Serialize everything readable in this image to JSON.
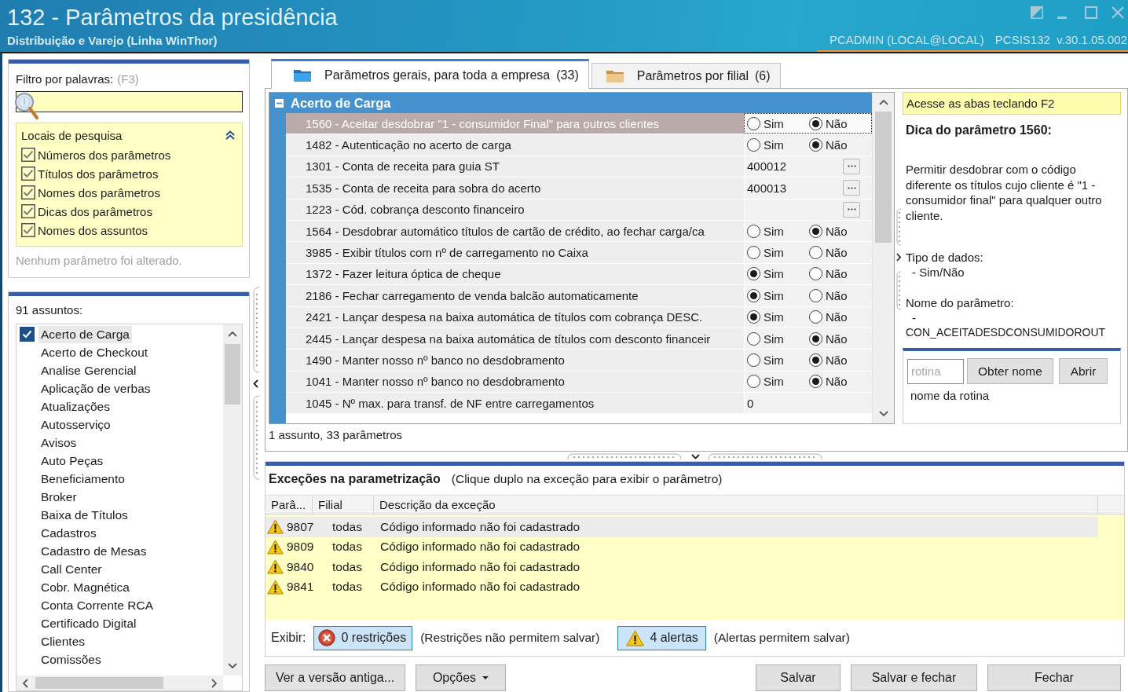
{
  "window": {
    "title": "132 - Parâmetros da presidência",
    "subtitle": "Distribuição e Varejo (Linha WinThor)",
    "user": "PCADMIN (LOCAL@LOCAL)",
    "version": "PCSIS132  v.30.1.05.002"
  },
  "filter": {
    "label": "Filtro por palavras:",
    "shortcut": "(F3)",
    "search_places": {
      "title": "Locais de pesquisa",
      "expanded": true,
      "options": [
        {
          "label": "Números dos parâmetros",
          "checked": true
        },
        {
          "label": "Títulos dos parâmetros",
          "checked": true
        },
        {
          "label": "Nomes dos parâmetros",
          "checked": true
        },
        {
          "label": "Dicas dos parâmetros",
          "checked": true
        },
        {
          "label": "Nomes dos assuntos",
          "checked": true
        }
      ]
    },
    "status": "Nenhum parâmetro foi alterado."
  },
  "subjects": {
    "count": "91 assuntos:",
    "items": [
      {
        "label": "Acerto de Carga",
        "checked": true,
        "selected": true
      },
      {
        "label": "Acerto de Checkout",
        "checked": false,
        "selected": false
      },
      {
        "label": "Analise Gerencial",
        "checked": false,
        "selected": false
      },
      {
        "label": "Aplicação de verbas",
        "checked": false,
        "selected": false
      },
      {
        "label": "Atualizações",
        "checked": false,
        "selected": false
      },
      {
        "label": "Autosserviço",
        "checked": false,
        "selected": false
      },
      {
        "label": "Avisos",
        "checked": false,
        "selected": false
      },
      {
        "label": "Auto Peças",
        "checked": false,
        "selected": false
      },
      {
        "label": "Beneficiamento",
        "checked": false,
        "selected": false
      },
      {
        "label": "Broker",
        "checked": false,
        "selected": false
      },
      {
        "label": "Baixa de Títulos",
        "checked": false,
        "selected": false
      },
      {
        "label": "Cadastros",
        "checked": false,
        "selected": false
      },
      {
        "label": "Cadastro de Mesas",
        "checked": false,
        "selected": false
      },
      {
        "label": "Call Center",
        "checked": false,
        "selected": false
      },
      {
        "label": "Cobr. Magnética",
        "checked": false,
        "selected": false
      },
      {
        "label": "Conta Corrente RCA",
        "checked": false,
        "selected": false
      },
      {
        "label": "Certificado Digital",
        "checked": false,
        "selected": false
      },
      {
        "label": "Clientes",
        "checked": false,
        "selected": false
      },
      {
        "label": "Comissões",
        "checked": false,
        "selected": false
      }
    ]
  },
  "tabs": [
    {
      "label": "Parâmetros gerais, para toda a empresa",
      "count": "(33)",
      "selected": true
    },
    {
      "label": "Parâmetros por filial",
      "count": "(6)",
      "selected": false
    }
  ],
  "parameters": {
    "group": {
      "title": "Acerto de Carga",
      "expanded": true
    },
    "rows": [
      {
        "label": "1560 - Aceitar desdobrar \"1 - consumidor Final\" para outros clientes",
        "kind": "yesno",
        "selected": true,
        "options": [
          {
            "label": "Sim",
            "selected": false
          },
          {
            "label": "Não",
            "selected": true
          }
        ]
      },
      {
        "label": "1482 - Autenticação no acerto de carga",
        "kind": "yesno",
        "selected": false,
        "options": [
          {
            "label": "Sim",
            "selected": false
          },
          {
            "label": "Não",
            "selected": true
          }
        ]
      },
      {
        "label": "1301 - Conta de receita para guia ST",
        "kind": "lookup",
        "selected": false,
        "value": "400012"
      },
      {
        "label": "1535 - Conta de receita para sobra do acerto",
        "kind": "lookup",
        "selected": false,
        "value": "400013"
      },
      {
        "label": "1223 - Cód. cobrança desconto financeiro",
        "kind": "lookup",
        "selected": false
      },
      {
        "label": "1564 - Desdobrar automático títulos de cartão de crédito, ao fechar carga/ca",
        "kind": "yesno",
        "selected": false,
        "options": [
          {
            "label": "Sim",
            "selected": false
          },
          {
            "label": "Não",
            "selected": true
          }
        ]
      },
      {
        "label": "3985 - Exibir títulos com nº de carregamento no Caixa",
        "kind": "yesno",
        "selected": false,
        "options": [
          {
            "label": "Sim",
            "selected": false
          },
          {
            "label": "Não",
            "selected": false
          }
        ]
      },
      {
        "label": "1372 - Fazer leitura óptica de cheque",
        "kind": "yesno",
        "selected": false,
        "options": [
          {
            "label": "Sim",
            "selected": true
          },
          {
            "label": "Não",
            "selected": false
          }
        ]
      },
      {
        "label": "2186 - Fechar carregamento de venda balcão automaticamente",
        "kind": "yesno",
        "selected": false,
        "options": [
          {
            "label": "Sim",
            "selected": true
          },
          {
            "label": "Não",
            "selected": false
          }
        ]
      },
      {
        "label": "2421 - Lançar despesa na baixa automática de títulos com cobrança DESC.",
        "kind": "yesno",
        "selected": false,
        "options": [
          {
            "label": "Sim",
            "selected": true
          },
          {
            "label": "Não",
            "selected": false
          }
        ]
      },
      {
        "label": "2445 - Lançar despesa na baixa automática de títulos com desconto financeir",
        "kind": "yesno",
        "selected": false,
        "options": [
          {
            "label": "Sim",
            "selected": false
          },
          {
            "label": "Não",
            "selected": true
          }
        ]
      },
      {
        "label": "1490 - Manter nosso nº banco no desdobramento",
        "kind": "yesno",
        "selected": false,
        "options": [
          {
            "label": "Sim",
            "selected": false
          },
          {
            "label": "Não",
            "selected": true
          }
        ]
      },
      {
        "label": "1041 - Manter nosso nº banco no desdobramento",
        "kind": "yesno",
        "selected": false,
        "options": [
          {
            "label": "Sim",
            "selected": false
          },
          {
            "label": "Não",
            "selected": true
          }
        ]
      },
      {
        "label": "1045 - Nº max. para transf. de NF entre carregamentos",
        "kind": "number",
        "selected": false,
        "value": "0"
      }
    ],
    "summary": "1 assunto, 33 parâmetros"
  },
  "hint": {
    "shortcut_note": "Acesse as abas teclando F2",
    "heading": "Dica do parâmetro 1560:",
    "description": "Permitir desdobrar com o código diferente os títulos cujo cliente é \"1 - consumidor final\" para qualquer outro cliente.",
    "data_type_label": "Tipo de dados:",
    "data_type": "- Sim/Não",
    "name_label": "Nome do parâmetro:",
    "name_dash": "-",
    "name": "CON_ACEITADESDCONSUMIDOROUT"
  },
  "routine": {
    "placeholder": "rotina",
    "buttons": [
      "Obter nome",
      "Abrir"
    ],
    "result": "nome da rotina"
  },
  "exceptions": {
    "title": "Exceções na parametrização",
    "note": "(Clique duplo na exceção para exibir o parâmetro)",
    "columns": [
      "Parâ...",
      "Filial",
      "Descrição da exceção"
    ],
    "rows": [
      {
        "kind": "alert",
        "param": "9807",
        "branch": "todas",
        "description": "Código informado não foi cadastrado",
        "selected": true
      },
      {
        "kind": "alert",
        "param": "9809",
        "branch": "todas",
        "description": "Código informado não foi cadastrado",
        "selected": false
      },
      {
        "kind": "alert",
        "param": "9840",
        "branch": "todas",
        "description": "Código informado não foi cadastrado",
        "selected": false
      },
      {
        "kind": "alert",
        "param": "9841",
        "branch": "todas",
        "description": "Código informado não foi cadastrado",
        "selected": false
      }
    ],
    "show_label": "Exibir:",
    "filters": [
      {
        "kind": "restriction",
        "label": "0 restrições",
        "pressed": true,
        "note": "(Restrições não permitem salvar)"
      },
      {
        "kind": "alert",
        "label": "4 alertas",
        "pressed": true,
        "note": "(Alertas permitem salvar)"
      }
    ]
  },
  "buttons_left": [
    {
      "label": "Ver a versão antiga..."
    },
    {
      "label": "Opções",
      "menu": true
    }
  ],
  "buttons_right": [
    {
      "label": "Salvar"
    },
    {
      "label": "Salvar e fechar"
    },
    {
      "label": "Fechar"
    }
  ]
}
